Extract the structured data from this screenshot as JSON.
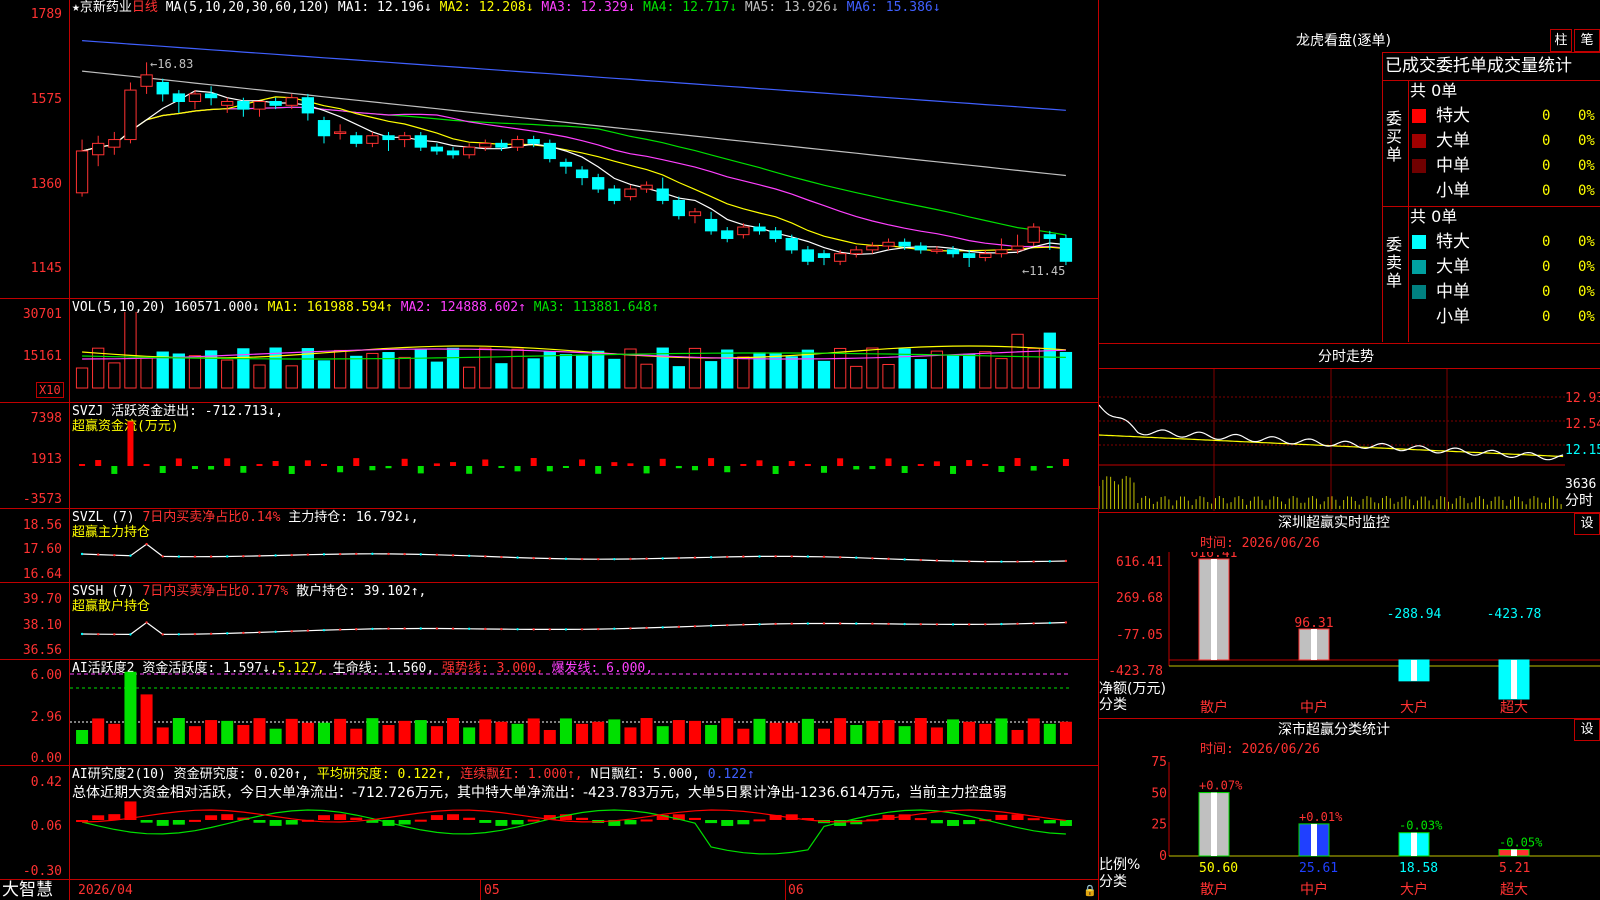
{
  "stock": {
    "name": "京新药业",
    "period": "日线"
  },
  "main": {
    "ma_title": "MA(5,10,20,30,60,120)",
    "ma": [
      {
        "label": "MA1: 12.196↓",
        "color": "#ffffff"
      },
      {
        "label": "MA2: 12.208↓",
        "color": "#ffff00"
      },
      {
        "label": "MA3: 12.329↓",
        "color": "#ff40ff"
      },
      {
        "label": "MA4: 12.717↓",
        "color": "#00e000"
      },
      {
        "label": "MA5: 13.926↓",
        "color": "#c0c0c0"
      },
      {
        "label": "MA6: 15.386↓",
        "color": "#4060ff"
      }
    ],
    "y_labels": [
      "1789",
      "1575",
      "1360",
      "1145"
    ],
    "high_mark": "16.83",
    "low_mark": "11.45"
  },
  "vol": {
    "title": "VOL(5,10,20)",
    "value": "160571.000↓",
    "ma1": "MA1: 161988.594↑",
    "ma2": "MA2: 124888.602↑",
    "ma3": "MA3: 113881.648↑",
    "y_labels": [
      "30701",
      "15161"
    ],
    "unit": "X10"
  },
  "svzj": {
    "title": "SVZJ",
    "label": "活跃资金进出: -712.713↓,",
    "sub": "超赢资金流(万元)",
    "y_labels": [
      "7398",
      "1913",
      "-3573"
    ]
  },
  "svzl": {
    "title": "SVZL (7)",
    "ratio": "7日内买卖净占比0.14%",
    "hold": "主力持仓: 16.792↓,",
    "sub": "超赢主力持仓",
    "y_labels": [
      "18.56",
      "17.60",
      "16.64"
    ]
  },
  "svsh": {
    "title": "SVSH (7)",
    "ratio": "7日内买卖净占比0.177%",
    "hold": "散户持仓: 39.102↑,",
    "sub": "超赢散户持仓",
    "y_labels": [
      "39.70",
      "38.10",
      "36.56"
    ]
  },
  "ai1": {
    "title": "AI活跃度2",
    "act": "资金活跃度: 1.597↓,",
    "v2": "5.127,",
    "life": "生命线: 1.560,",
    "strong": "强势线: 3.000,",
    "burst": "爆发线: 6.000,",
    "y_labels": [
      "6.00",
      "2.96",
      "0.00"
    ]
  },
  "ai2": {
    "title": "AI研究度2(10)",
    "res": "资金研究度: 0.020↑,",
    "avg": "平均研究度: 0.122↑,",
    "cont": "连续飘红: 1.000↑,",
    "nday": "N日飘红: 5.000,",
    "last": "0.122↑",
    "summary": "总体近期大资金相对活跃，今日大单净流出：-712.726万元，其中特大单净流出：-423.783万元，大单5日累计净出-1236.614万元，当前主力控盘弱",
    "y_labels": [
      "0.42",
      "0.06",
      "-0.30"
    ]
  },
  "xaxis": {
    "brand": "大智慧",
    "labels": [
      "2026/04",
      "05",
      "06"
    ]
  },
  "lhb": {
    "title": "龙虎看盘(逐单)",
    "btn1": "柱",
    "btn2": "笔",
    "subtitle": "已成交委托单成交量统计",
    "buy_label": "委买单",
    "sell_label": "委卖单",
    "buy_total": "共 0单",
    "sell_total": "共 0单",
    "buy_rows": [
      {
        "name": "特大",
        "count": "0",
        "pct": "0%",
        "color": "#ff0000"
      },
      {
        "name": "大单",
        "count": "0",
        "pct": "0%",
        "color": "#a00000"
      },
      {
        "name": "中单",
        "count": "0",
        "pct": "0%",
        "color": "#700000"
      },
      {
        "name": "小单",
        "count": "0",
        "pct": "0%",
        "color": "#000000"
      }
    ],
    "sell_rows": [
      {
        "name": "特大",
        "count": "0",
        "pct": "0%",
        "color": "#00ffff"
      },
      {
        "name": "大单",
        "count": "0",
        "pct": "0%",
        "color": "#00a0a0"
      },
      {
        "name": "中单",
        "count": "0",
        "pct": "0%",
        "color": "#008080"
      },
      {
        "name": "小单",
        "count": "0",
        "pct": "0%",
        "color": "#000000"
      }
    ]
  },
  "fenshi": {
    "title": "分时走势",
    "y_labels": [
      "12.93",
      "12.54",
      "12.15"
    ],
    "vol_label": "3636",
    "foot": "分时"
  },
  "sz_monitor": {
    "title": "深圳超赢实时监控",
    "btn": "设",
    "time": "时间: 2026/06/26",
    "y_labels": [
      "616.41",
      "269.68",
      "-77.05",
      "-423.78"
    ],
    "bar_labels": [
      "616.41",
      "96.31",
      "-288.94",
      "-423.78"
    ],
    "values": [
      616.41,
      96.31,
      -288.94,
      -423.78
    ],
    "categories": [
      "散户",
      "中户",
      "大户",
      "超大"
    ],
    "unit1": "净额(万元)",
    "unit2": "分类"
  },
  "sz_stats": {
    "title": "深市超赢分类统计",
    "btn": "设",
    "time": "时间: 2026/06/26",
    "y_labels": [
      "75",
      "50",
      "25",
      "0"
    ],
    "pct_labels": [
      "+0.07%",
      "+0.01%",
      "-0.03%",
      "-0.05%"
    ],
    "values": [
      50.6,
      25.61,
      18.58,
      5.21
    ],
    "value_labels": [
      "50.60",
      "25.61",
      "18.58",
      "5.21"
    ],
    "categories": [
      "散户",
      "中户",
      "大户",
      "超大"
    ],
    "unit1": "比例%",
    "unit2": "分类"
  },
  "chart_data": {
    "type": "candlestick",
    "title": "京新药业 日线",
    "y_axis_labels": [
      17.89,
      15.75,
      13.6,
      11.45
    ],
    "high": 16.83,
    "low": 11.45,
    "x_labels": [
      "2026/04",
      "05",
      "06"
    ],
    "ma_last": {
      "MA5": 12.196,
      "MA10": 12.208,
      "MA20": 12.329,
      "MA30": 12.717,
      "MA60": 13.926,
      "MA120": 15.386
    },
    "candles": [
      [
        13.4,
        14.5,
        14.8,
        13.3
      ],
      [
        14.4,
        14.7,
        14.9,
        14.1
      ],
      [
        14.6,
        14.8,
        15.0,
        14.4
      ],
      [
        14.8,
        16.1,
        16.3,
        14.7
      ],
      [
        16.2,
        16.5,
        16.83,
        16.0
      ],
      [
        16.3,
        16.0,
        16.4,
        15.8
      ],
      [
        16.0,
        15.8,
        16.1,
        15.5
      ],
      [
        15.8,
        16.0,
        16.1,
        15.6
      ],
      [
        16.0,
        15.9,
        16.2,
        15.7
      ],
      [
        15.7,
        15.8,
        15.9,
        15.5
      ],
      [
        15.8,
        15.6,
        15.9,
        15.4
      ],
      [
        15.6,
        15.8,
        15.8,
        15.4
      ],
      [
        15.8,
        15.7,
        15.9,
        15.6
      ],
      [
        15.7,
        15.9,
        16.0,
        15.6
      ],
      [
        15.9,
        15.5,
        16.0,
        15.3
      ],
      [
        15.3,
        14.9,
        15.4,
        14.7
      ],
      [
        15.0,
        15.0,
        15.2,
        14.8
      ],
      [
        14.9,
        14.7,
        15.0,
        14.6
      ],
      [
        14.7,
        14.9,
        15.0,
        14.6
      ],
      [
        14.9,
        14.8,
        15.0,
        14.5
      ],
      [
        14.8,
        14.9,
        15.0,
        14.6
      ],
      [
        14.9,
        14.6,
        15.0,
        14.5
      ],
      [
        14.6,
        14.5,
        14.7,
        14.4
      ],
      [
        14.5,
        14.4,
        14.6,
        14.3
      ],
      [
        14.4,
        14.6,
        14.7,
        14.3
      ],
      [
        14.6,
        14.7,
        14.8,
        14.5
      ],
      [
        14.7,
        14.6,
        14.8,
        14.5
      ],
      [
        14.6,
        14.8,
        14.9,
        14.5
      ],
      [
        14.8,
        14.7,
        14.9,
        14.6
      ],
      [
        14.7,
        14.3,
        14.8,
        14.2
      ],
      [
        14.2,
        14.1,
        14.3,
        13.9
      ],
      [
        14.0,
        13.8,
        14.1,
        13.6
      ],
      [
        13.8,
        13.5,
        13.9,
        13.4
      ],
      [
        13.5,
        13.2,
        13.6,
        13.1
      ],
      [
        13.3,
        13.5,
        13.6,
        13.2
      ],
      [
        13.5,
        13.6,
        13.7,
        13.4
      ],
      [
        13.5,
        13.2,
        13.8,
        13.1
      ],
      [
        13.2,
        12.8,
        13.3,
        12.7
      ],
      [
        12.8,
        12.9,
        13.0,
        12.6
      ],
      [
        12.7,
        12.4,
        12.9,
        12.3
      ],
      [
        12.4,
        12.2,
        12.5,
        12.1
      ],
      [
        12.3,
        12.5,
        12.6,
        12.2
      ],
      [
        12.5,
        12.4,
        12.6,
        12.3
      ],
      [
        12.4,
        12.2,
        12.5,
        12.1
      ],
      [
        12.2,
        11.9,
        12.3,
        11.8
      ],
      [
        11.9,
        11.6,
        12.0,
        11.5
      ],
      [
        11.8,
        11.7,
        11.9,
        11.5
      ],
      [
        11.6,
        11.8,
        11.9,
        11.5
      ],
      [
        11.8,
        11.9,
        12.0,
        11.7
      ],
      [
        11.9,
        12.0,
        12.1,
        11.8
      ],
      [
        12.0,
        12.1,
        12.2,
        11.9
      ],
      [
        12.1,
        12.0,
        12.2,
        11.9
      ],
      [
        12.0,
        11.9,
        12.1,
        11.8
      ],
      [
        11.9,
        11.9,
        12.0,
        11.8
      ],
      [
        11.9,
        11.8,
        12.0,
        11.7
      ],
      [
        11.8,
        11.7,
        11.9,
        11.45
      ],
      [
        11.7,
        11.8,
        11.9,
        11.6
      ],
      [
        11.8,
        11.9,
        12.2,
        11.7
      ],
      [
        11.9,
        12.0,
        12.3,
        11.8
      ],
      [
        12.1,
        12.5,
        12.6,
        12.0
      ],
      [
        12.3,
        12.2,
        12.4,
        11.9
      ],
      [
        12.2,
        11.6,
        12.3,
        11.5
      ]
    ]
  }
}
